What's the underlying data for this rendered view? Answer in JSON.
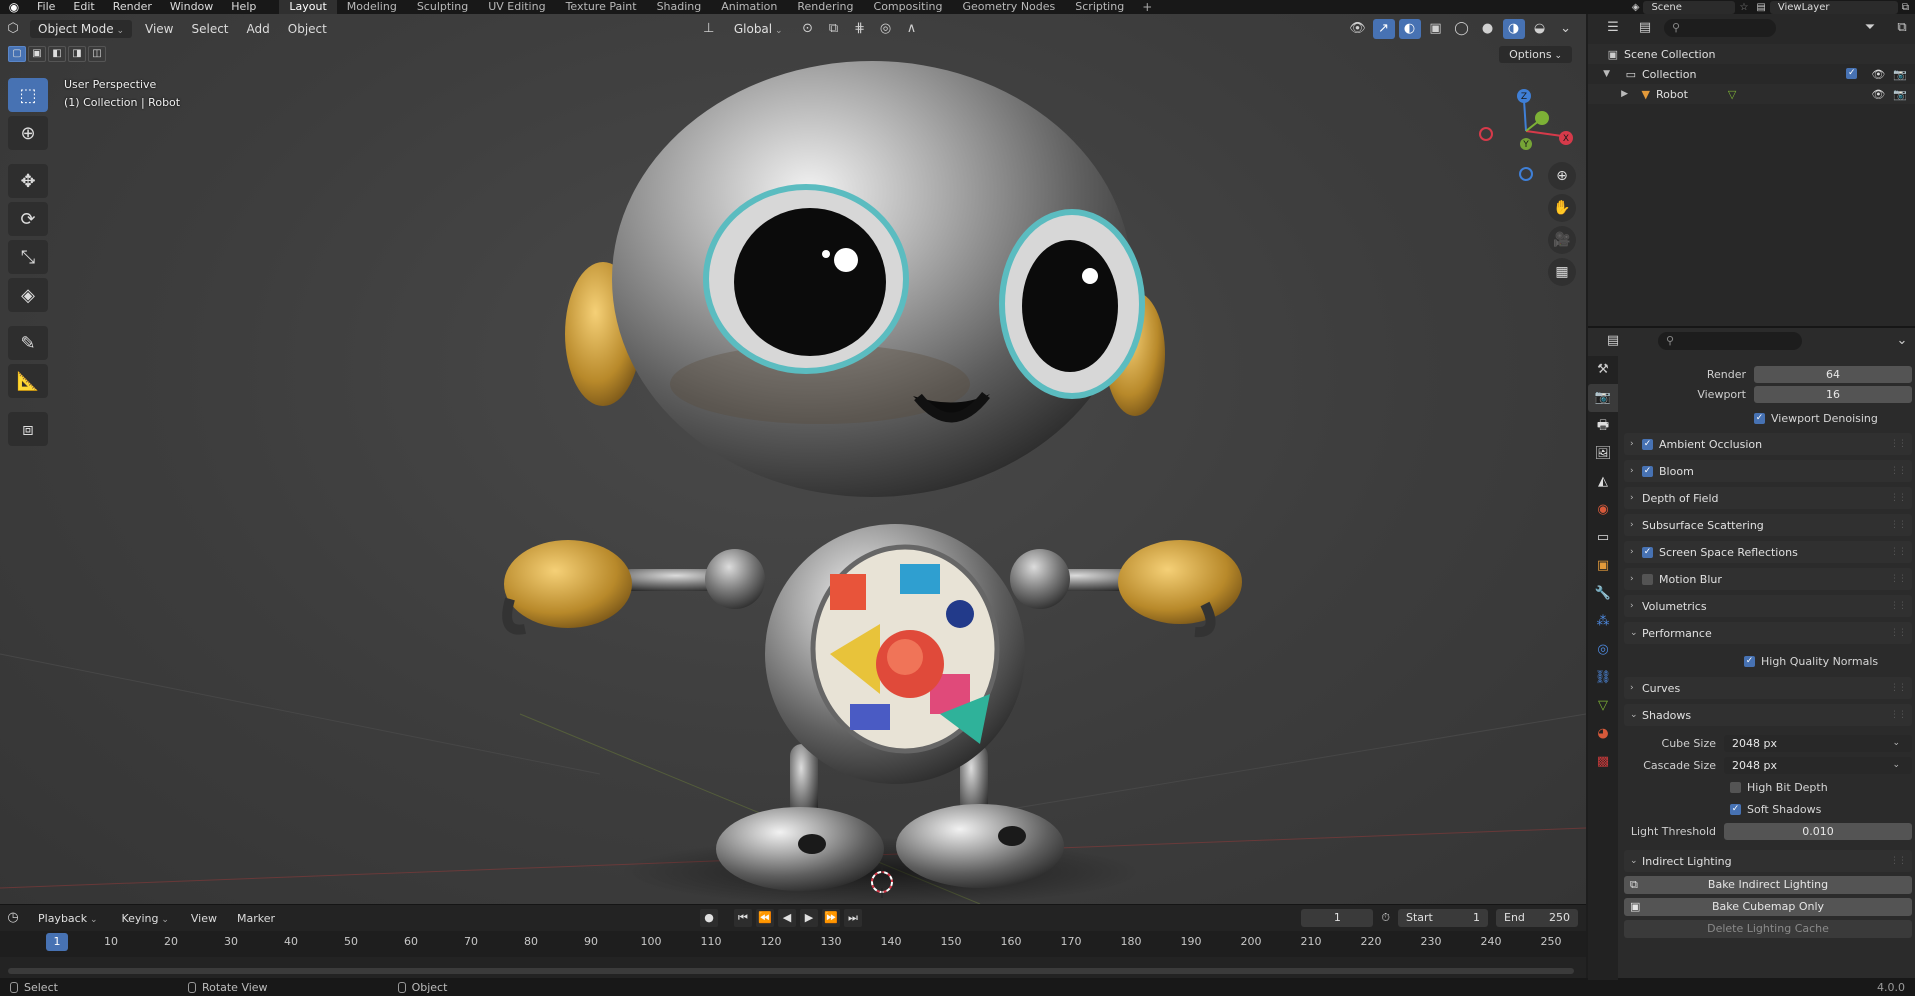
{
  "topbar": {
    "menus": [
      "File",
      "Edit",
      "Render",
      "Window",
      "Help"
    ],
    "workspaces": [
      "Layout",
      "Modeling",
      "Sculpting",
      "UV Editing",
      "Texture Paint",
      "Shading",
      "Animation",
      "Rendering",
      "Compositing",
      "Geometry Nodes",
      "Scripting"
    ],
    "active_workspace": "Layout",
    "scene": "Scene",
    "view_layer": "ViewLayer"
  },
  "viewport": {
    "mode": "Object Mode",
    "menus": [
      "View",
      "Select",
      "Add",
      "Object"
    ],
    "transform_orientation": "Global",
    "options_label": "Options",
    "perspective_label": "User Perspective",
    "collection_label": "(1) Collection | Robot",
    "gizmo_axes": {
      "x": "X",
      "y": "Y",
      "z": "Z"
    },
    "tools": [
      "select-box",
      "cursor",
      "move",
      "rotate",
      "scale",
      "transform",
      "annotate",
      "measure",
      "add-cube"
    ]
  },
  "timeline": {
    "menus": [
      "Playback",
      "Keying",
      "View",
      "Marker"
    ],
    "current_frame": "1",
    "start_label": "Start",
    "start": "1",
    "end_label": "End",
    "end": "250",
    "ruler_ticks": [
      "1",
      "10",
      "20",
      "30",
      "40",
      "50",
      "60",
      "70",
      "80",
      "90",
      "100",
      "110",
      "120",
      "130",
      "140",
      "150",
      "160",
      "170",
      "180",
      "190",
      "200",
      "210",
      "220",
      "230",
      "240",
      "250"
    ]
  },
  "statusbar": {
    "left": "Select",
    "middle": "Rotate View",
    "right": "Object",
    "version": "4.0.0"
  },
  "outliner": {
    "rows": [
      {
        "label": "Scene Collection"
      },
      {
        "label": "Collection"
      },
      {
        "label": "Robot"
      }
    ]
  },
  "properties": {
    "samples": {
      "render_label": "Render",
      "render": "64",
      "viewport_label": "Viewport",
      "viewport": "16"
    },
    "viewport_denoising": "Viewport Denoising",
    "panels": {
      "ambient_occlusion": "Ambient Occlusion",
      "bloom": "Bloom",
      "depth_of_field": "Depth of Field",
      "subsurface": "Subsurface Scattering",
      "ssr": "Screen Space Reflections",
      "motion_blur": "Motion Blur",
      "volumetrics": "Volumetrics",
      "performance": "Performance",
      "curves": "Curves",
      "shadows": "Shadows",
      "indirect": "Indirect Lighting"
    },
    "high_quality_normals": "High Quality Normals",
    "shadows": {
      "cube_size_label": "Cube Size",
      "cube_size": "2048 px",
      "cascade_size_label": "Cascade Size",
      "cascade_size": "2048 px",
      "high_bit_depth": "High Bit Depth",
      "soft_shadows": "Soft Shadows",
      "light_threshold_label": "Light Threshold",
      "light_threshold": "0.010"
    },
    "buttons": {
      "bake_indirect": "Bake Indirect Lighting",
      "bake_cubemap": "Bake Cubemap Only",
      "delete_cache": "Delete Lighting Cache"
    }
  },
  "colors": {
    "accent": "#4772b3",
    "x_axis": "#d63a4a",
    "y_axis": "#7db136",
    "z_axis": "#3f7fd6"
  }
}
